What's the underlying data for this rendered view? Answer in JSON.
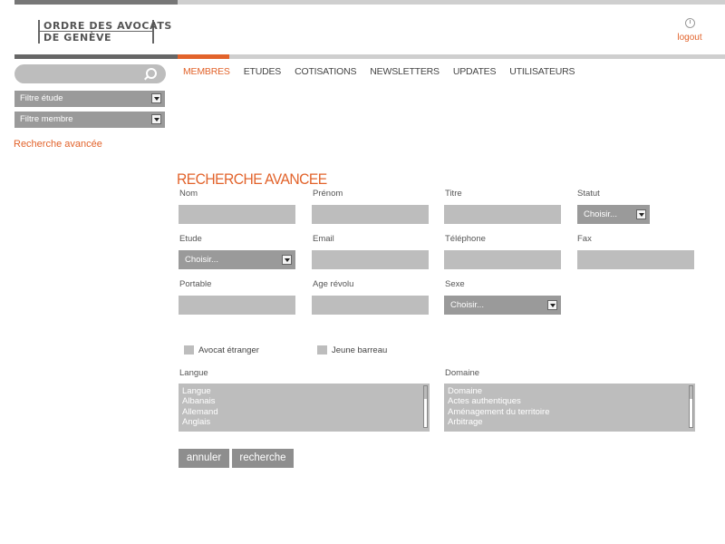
{
  "header": {
    "logo_line1": "ORDRE DES AVOCATS",
    "logo_line2": "DE GENÈVE",
    "logout_label": "logout"
  },
  "nav": {
    "items": [
      "MEMBRES",
      "ETUDES",
      "COTISATIONS",
      "NEWSLETTERS",
      "UPDATES",
      "UTILISATEURS"
    ],
    "active": "MEMBRES"
  },
  "sidebar": {
    "search_placeholder": "",
    "filter_etude": "Filtre étude",
    "filter_membre": "Filtre membre",
    "advanced_link": "Recherche avancée"
  },
  "form": {
    "title": "RECHERCHE AVANCEE",
    "labels": {
      "nom": "Nom",
      "prenom": "Prénom",
      "titre": "Titre",
      "statut": "Statut",
      "etude": "Etude",
      "email": "Email",
      "telephone": "Téléphone",
      "fax": "Fax",
      "portable": "Portable",
      "age": "Age révolu",
      "sexe": "Sexe",
      "langue": "Langue",
      "domaine": "Domaine"
    },
    "values": {
      "statut": "Choisir...",
      "etude": "Choisir...",
      "sexe": "Choisir..."
    },
    "checkboxes": {
      "avocat_etranger": "Avocat étranger",
      "jeune_barreau": "Jeune barreau"
    },
    "langue_options": [
      "Langue",
      "Albanais",
      "Allemand",
      "Anglais"
    ],
    "domaine_options": [
      "Domaine",
      "Actes authentiques",
      "Aménagement du territoire",
      "Arbitrage"
    ],
    "buttons": {
      "cancel": "annuler",
      "search": "recherche"
    }
  },
  "colors": {
    "accent": "#e2632b",
    "input_gray": "#bdbdbd",
    "select_gray": "#9a9a9a"
  }
}
